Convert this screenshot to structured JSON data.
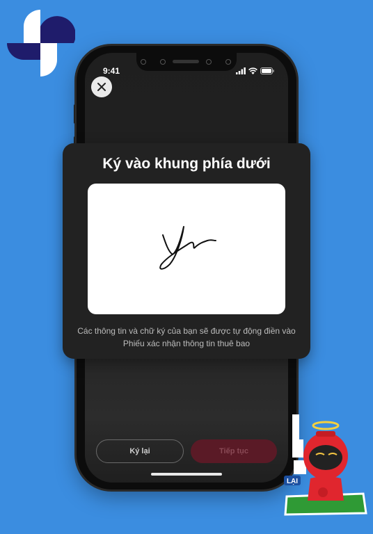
{
  "status_bar": {
    "time": "9:41"
  },
  "modal": {
    "title": "Ký vào khung phía dưới",
    "signature_text": "Ya",
    "note": "Các thông tin và chữ ký của bạn sẽ được tự động điền vào Phiếu xác nhận thông tin thuê bao"
  },
  "actions": {
    "sign_again_label": "Ký lại",
    "continue_label": "Tiếp tục"
  },
  "sticker": {
    "caption": "LẠI"
  },
  "colors": {
    "background": "#3b8de0",
    "card": "#222222",
    "continue_disabled": "#5a1a26",
    "logo_navy": "#1f1c6b"
  },
  "icons": {
    "close": "close-icon",
    "brand": "brand-logo-icon",
    "signal": "signal-icon",
    "wifi": "wifi-icon",
    "battery": "battery-icon"
  }
}
